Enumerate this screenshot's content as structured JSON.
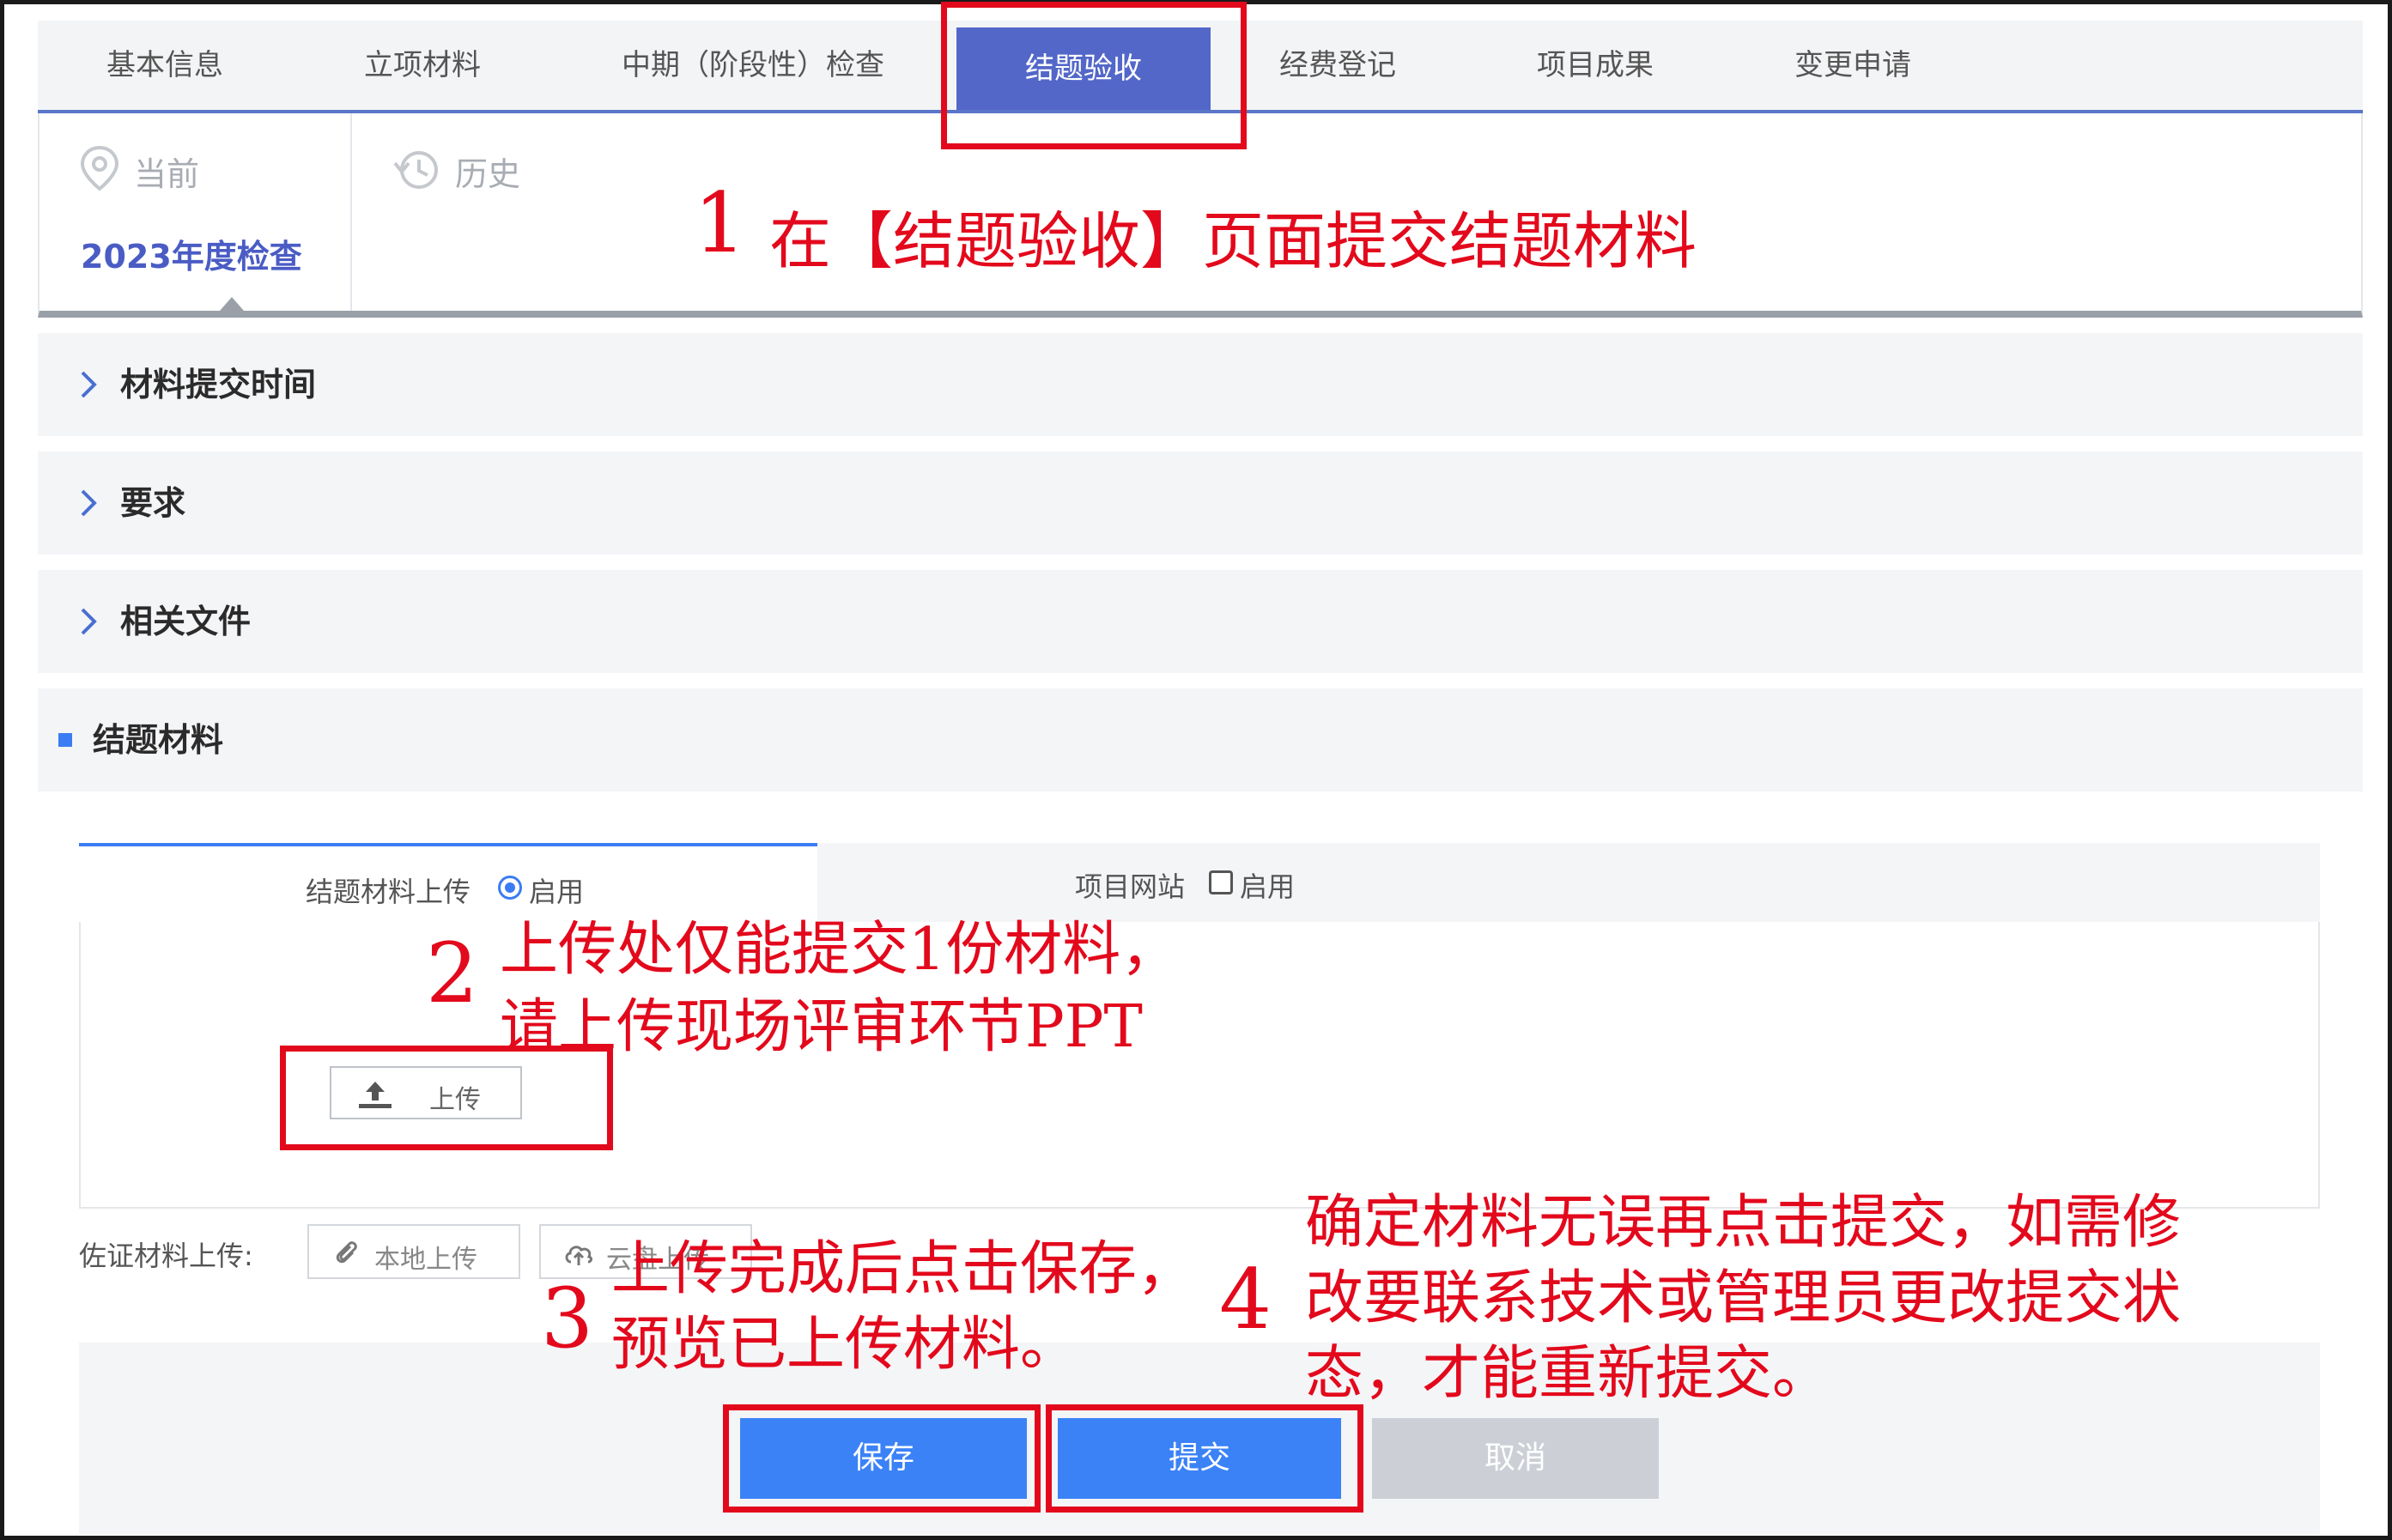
{
  "colors": {
    "accent": "#5367c9",
    "primary_button": "#3b82f6",
    "annotation_red": "#e3091c"
  },
  "tabs": [
    {
      "label": "基本信息"
    },
    {
      "label": "立项材料"
    },
    {
      "label": "中期（阶段性）检查"
    },
    {
      "label": "结题验收",
      "active": true
    },
    {
      "label": "经费登记"
    },
    {
      "label": "项目成果"
    },
    {
      "label": "变更申请"
    }
  ],
  "period": {
    "current_label": "当前",
    "current_year": "2023年度检查",
    "history_label": "历史"
  },
  "sections": {
    "submit_time": "材料提交时间",
    "requirements": "要求",
    "related_files": "相关文件",
    "final_materials": "结题材料"
  },
  "upload": {
    "tab1_label": "结题材料上传",
    "tab1_option": "启用",
    "tab2_label": "项目网站",
    "tab2_option": "启用",
    "upload_button": "上传",
    "evidence_label": "佐证材料上传:",
    "local_upload": "本地上传",
    "cloud_upload": "云盘上传"
  },
  "buttons": {
    "save": "保存",
    "submit": "提交",
    "cancel": "取消"
  },
  "annotations": {
    "step1_num": "1",
    "step1_text": "在【结题验收】页面提交结题材料",
    "step2_num": "2",
    "step2_line1": "上传处仅能提交1份材料，",
    "step2_line2": "请上传现场评审环节PPT",
    "step3_num": "3",
    "step3_line1": "上传完成后点击保存，",
    "step3_line2": "预览已上传材料。",
    "step4_num": "4",
    "step4_line1": "确定材料无误再点击提交，如需修",
    "step4_line2": "改要联系技术或管理员更改提交状",
    "step4_line3": "态，才能重新提交。"
  }
}
